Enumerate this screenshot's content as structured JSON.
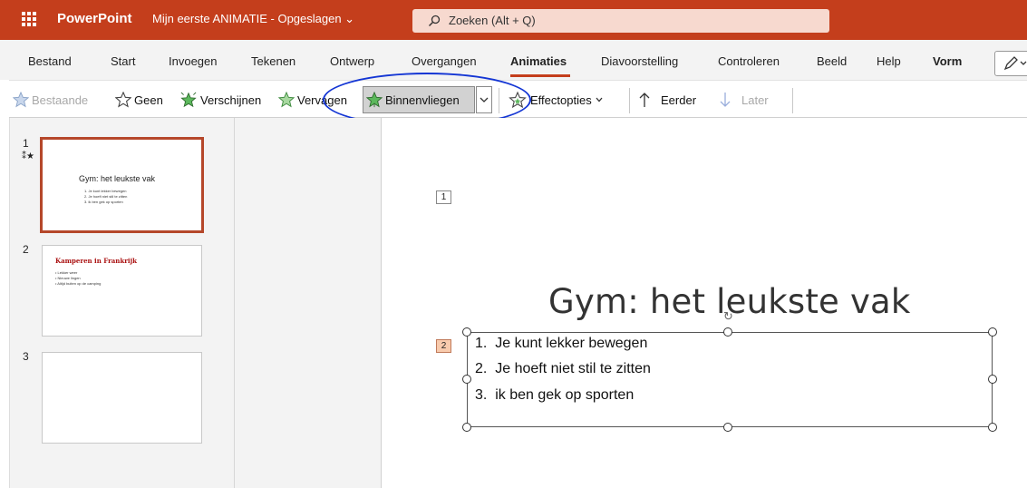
{
  "titlebar": {
    "app_name": "PowerPoint",
    "doc_title": "Mijn eerste ANIMATIE - Opgeslagen ⌄",
    "search_placeholder": "Zoeken (Alt + Q)",
    "brand_color": "#c43e1c"
  },
  "menu": {
    "tabs": [
      "Bestand",
      "Start",
      "Invoegen",
      "Tekenen",
      "Ontwerp",
      "Overgangen",
      "Animaties",
      "Diavoorstelling",
      "Controleren",
      "Beeld",
      "Help",
      "Vorm"
    ],
    "active_tab": "Animaties"
  },
  "toolbar": {
    "items": [
      {
        "label": "Bestaande",
        "icon": "star-outline-icon",
        "enabled": false
      },
      {
        "label": "Geen",
        "icon": "star-outline-icon",
        "enabled": true
      },
      {
        "label": "Verschijnen",
        "icon": "star-burst-green-icon",
        "enabled": true
      },
      {
        "label": "Vervagen",
        "icon": "star-green-icon",
        "enabled": true
      },
      {
        "label": "Binnenvliegen",
        "icon": "star-fly-in-green-icon",
        "enabled": true,
        "selected": true
      }
    ],
    "effect_options": "Effectopties",
    "earlier": "Eerder",
    "later": "Later"
  },
  "slides": [
    {
      "number": "1",
      "has_animation": true,
      "title": "Gym: het leukste vak",
      "bullets": [
        "1. Je kunt lekker bewegen",
        "2. Je hoeft niet stil te zitten",
        "3. ik ben gek op sporten"
      ]
    },
    {
      "number": "2",
      "title": "Kamperen in Frankrijk",
      "bullets": [
        "• Lekker weer",
        "• Nieuwe lingen",
        "• Altijd buiten op de camping"
      ]
    },
    {
      "number": "3"
    }
  ],
  "canvas": {
    "tag1": "1",
    "tag2": "2",
    "title": "Gym: het leukste vak",
    "bullets": [
      "1.  Je kunt lekker bewegen",
      "2.  Je hoeft niet stil te zitten",
      "3.  ik ben gek op sporten"
    ]
  }
}
